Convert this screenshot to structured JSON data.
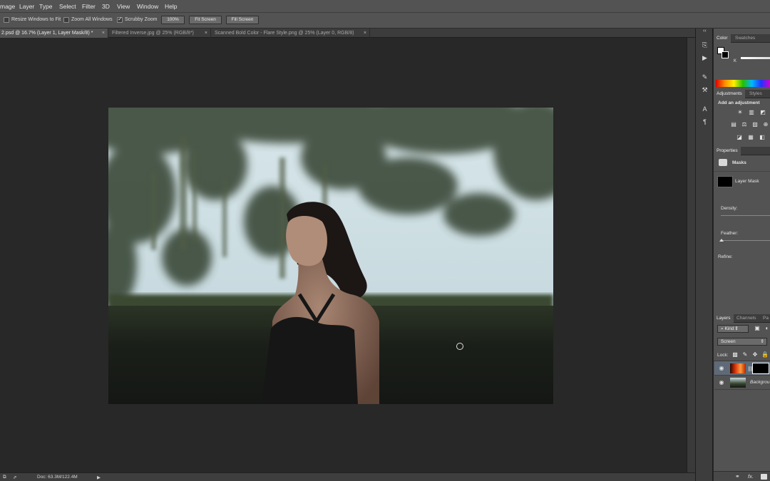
{
  "menu": {
    "items": [
      "mage",
      "Layer",
      "Type",
      "Select",
      "Filter",
      "3D",
      "View",
      "Window",
      "Help"
    ]
  },
  "options": {
    "resize_windows": "Resize Windows to Fit",
    "zoom_all": "Zoom All Windows",
    "scrubby_zoom": "Scrubby Zoom",
    "zoom_value": "100%",
    "fit_screen": "Fit Screen",
    "fill_screen": "Fill Screen"
  },
  "tabs": [
    {
      "label": "2.psd @ 16.7% (Layer 1, Layer Mask/8) *",
      "close": "×"
    },
    {
      "label": "Filtered Inverse.jpg @ 25% (RGB/8*)",
      "close": "×"
    },
    {
      "label": "Scanned Bold Color - Flare Style.png @ 25% (Layer 0, RGB/8)",
      "close": "×"
    }
  ],
  "status": {
    "doc": "Doc: 63.3M/122.4M"
  },
  "panels": {
    "collapse": "‹‹",
    "color_tabs": [
      "Color",
      "Swatches"
    ],
    "k_label": "K",
    "adjustment_tabs": [
      "Adjustments",
      "Styles"
    ],
    "add_adjustment": "Add an adjustment",
    "properties_tab": "Properties",
    "masks_label": "Masks",
    "layer_mask_label": "Layer Mask",
    "density_label": "Density:",
    "feather_label": "Feather:",
    "refine_label": "Refine:",
    "layers_tabs": [
      "Layers",
      "Channels",
      "Pa"
    ],
    "kind_select": "Kind",
    "blend_select": "Screen",
    "lock_label": "Lock:",
    "layers": [
      {
        "name": "",
        "visible": true
      },
      {
        "name": "Backgrou",
        "visible": true
      }
    ],
    "footer_icons": [
      "link-icon",
      "fx-icon",
      "mask-icon"
    ],
    "fx_label": "fx."
  },
  "colors": {
    "ui_panel": "#535353",
    "ui_dark": "#282828",
    "accent_active": "#f0f0f0"
  }
}
